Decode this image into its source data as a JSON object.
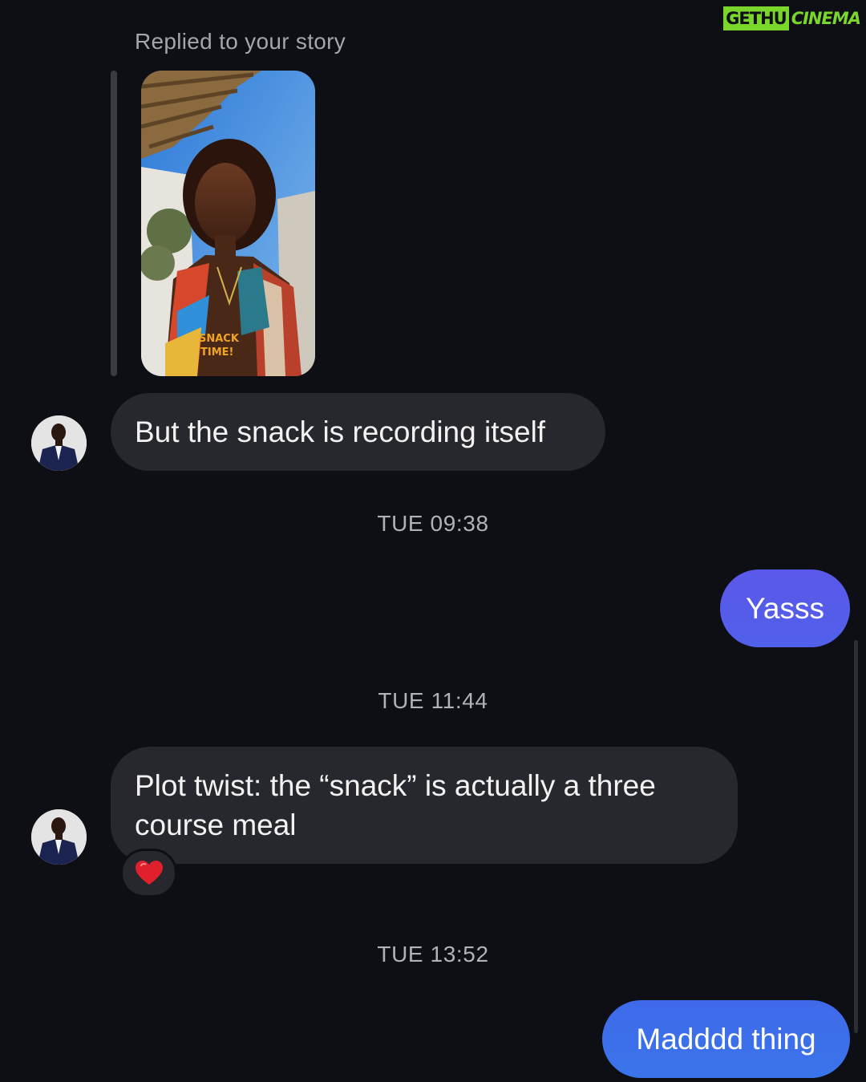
{
  "watermark": {
    "part_a": "GETHU",
    "part_b": "CINEMA"
  },
  "story_reply": {
    "label": "Replied to your story",
    "sticker_text": [
      "SNACK",
      "TIME!"
    ]
  },
  "messages": [
    {
      "direction": "incoming",
      "text": "But the snack is recording itself"
    },
    {
      "timestamp": "TUE 09:38"
    },
    {
      "direction": "outgoing",
      "text": "Yasss"
    },
    {
      "timestamp": "TUE 11:44"
    },
    {
      "direction": "incoming",
      "text": "Plot twist: the “snack” is actually a three course meal",
      "reaction": "heart-icon"
    },
    {
      "timestamp": "TUE 13:52"
    },
    {
      "direction": "outgoing",
      "text": "Madddd thing"
    }
  ],
  "colors": {
    "background": "#0e0f14",
    "incoming_bubble": "#26282e",
    "outgoing_bubble_top": "#5a58ea",
    "outgoing_bubble_bottom": "#3f6fea",
    "reaction_heart": "#e0202c",
    "watermark": "#7bd62c"
  }
}
